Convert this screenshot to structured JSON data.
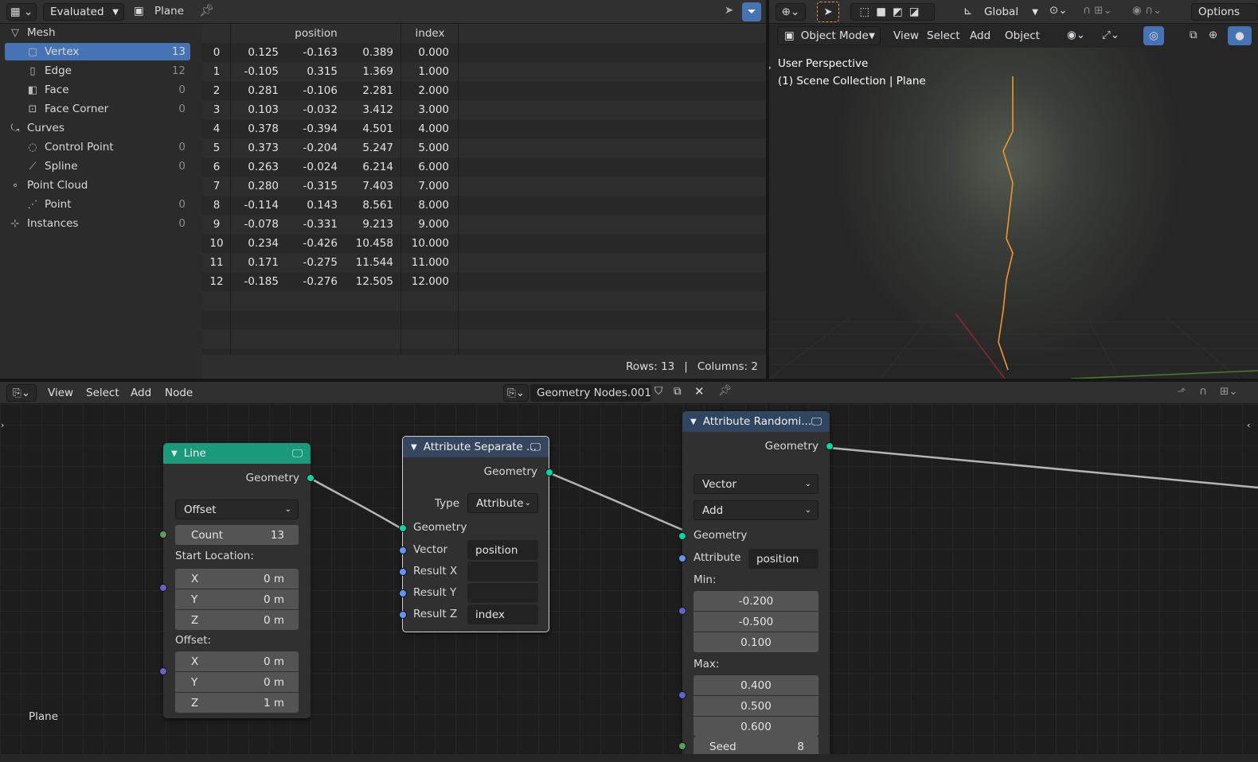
{
  "spreadsheet": {
    "evaluated_label": "Evaluated",
    "object_label": "Plane",
    "tree": [
      {
        "label": "Mesh",
        "count": "",
        "icon": "mesh-icon"
      },
      {
        "label": "Vertex",
        "count": "13",
        "icon": "vertex-icon"
      },
      {
        "label": "Edge",
        "count": "12",
        "icon": "edge-icon"
      },
      {
        "label": "Face",
        "count": "0",
        "icon": "face-icon"
      },
      {
        "label": "Face Corner",
        "count": "0",
        "icon": "face-corner-icon"
      },
      {
        "label": "Curves",
        "count": "",
        "icon": "curves-icon"
      },
      {
        "label": "Control Point",
        "count": "0",
        "icon": "control-point-icon"
      },
      {
        "label": "Spline",
        "count": "0",
        "icon": "spline-icon"
      },
      {
        "label": "Point Cloud",
        "count": "",
        "icon": "point-cloud-icon"
      },
      {
        "label": "Point",
        "count": "0",
        "icon": "point-icon"
      },
      {
        "label": "Instances",
        "count": "0",
        "icon": "instances-icon"
      }
    ],
    "columns": [
      "position",
      "index"
    ],
    "rows": [
      [
        "0",
        "0.125",
        "-0.163",
        "0.389",
        "0.000"
      ],
      [
        "1",
        "-0.105",
        "0.315",
        "1.369",
        "1.000"
      ],
      [
        "2",
        "0.281",
        "-0.106",
        "2.281",
        "2.000"
      ],
      [
        "3",
        "0.103",
        "-0.032",
        "3.412",
        "3.000"
      ],
      [
        "4",
        "0.378",
        "-0.394",
        "4.501",
        "4.000"
      ],
      [
        "5",
        "0.373",
        "-0.204",
        "5.247",
        "5.000"
      ],
      [
        "6",
        "0.263",
        "-0.024",
        "6.214",
        "6.000"
      ],
      [
        "7",
        "0.280",
        "-0.315",
        "7.403",
        "7.000"
      ],
      [
        "8",
        "-0.114",
        "0.143",
        "8.561",
        "8.000"
      ],
      [
        "9",
        "-0.078",
        "-0.331",
        "9.213",
        "9.000"
      ],
      [
        "10",
        "0.234",
        "-0.426",
        "10.458",
        "10.000"
      ],
      [
        "11",
        "0.171",
        "-0.275",
        "11.544",
        "11.000"
      ],
      [
        "12",
        "-0.185",
        "-0.276",
        "12.505",
        "12.000"
      ]
    ],
    "status_rows": "Rows: 13",
    "status_sep": "|",
    "status_cols": "Columns: 2"
  },
  "viewport": {
    "transform_orientation": "Global",
    "options_label": "Options",
    "mode_label": "Object Mode",
    "menus": [
      "View",
      "Select",
      "Add",
      "Object"
    ],
    "overlay_title": "User Perspective",
    "overlay_subtitle": "(1) Scene Collection | Plane"
  },
  "node_editor": {
    "menus": [
      "View",
      "Select",
      "Add",
      "Node"
    ],
    "tree_name": "Geometry Nodes.001",
    "object_label": "Plane",
    "line_node": {
      "title": "Line",
      "output": "Geometry",
      "mode": "Offset",
      "count_label": "Count",
      "count_value": "13",
      "start_label": "Start Location:",
      "start": [
        [
          "X",
          "0 m"
        ],
        [
          "Y",
          "0 m"
        ],
        [
          "Z",
          "0 m"
        ]
      ],
      "offset_label": "Offset:",
      "offset": [
        [
          "X",
          "0 m"
        ],
        [
          "Y",
          "0 m"
        ],
        [
          "Z",
          "1 m"
        ]
      ]
    },
    "separate_node": {
      "title": "Attribute Separate ...",
      "output": "Geometry",
      "type_label": "Type",
      "type_value": "Attribute",
      "inputs": [
        [
          "Geometry",
          ""
        ],
        [
          "Vector",
          "position"
        ],
        [
          "Result X",
          ""
        ],
        [
          "Result Y",
          ""
        ],
        [
          "Result Z",
          "index"
        ]
      ]
    },
    "randomize_node": {
      "title": "Attribute Randomi...",
      "output": "Geometry",
      "type_value": "Vector",
      "op_value": "Add",
      "geometry_label": "Geometry",
      "attribute_label": "Attribute",
      "attribute_value": "position",
      "min_label": "Min:",
      "min": [
        "-0.200",
        "-0.500",
        "0.100"
      ],
      "max_label": "Max:",
      "max": [
        "0.400",
        "0.500",
        "0.600"
      ],
      "seed_label": "Seed",
      "seed_value": "8"
    }
  },
  "colors": {
    "accent": "#4772b3",
    "line_header": "#1a9a7a",
    "randomize_header": "#30455f",
    "separate_header": "#35465e",
    "curve": "#f0952a"
  }
}
